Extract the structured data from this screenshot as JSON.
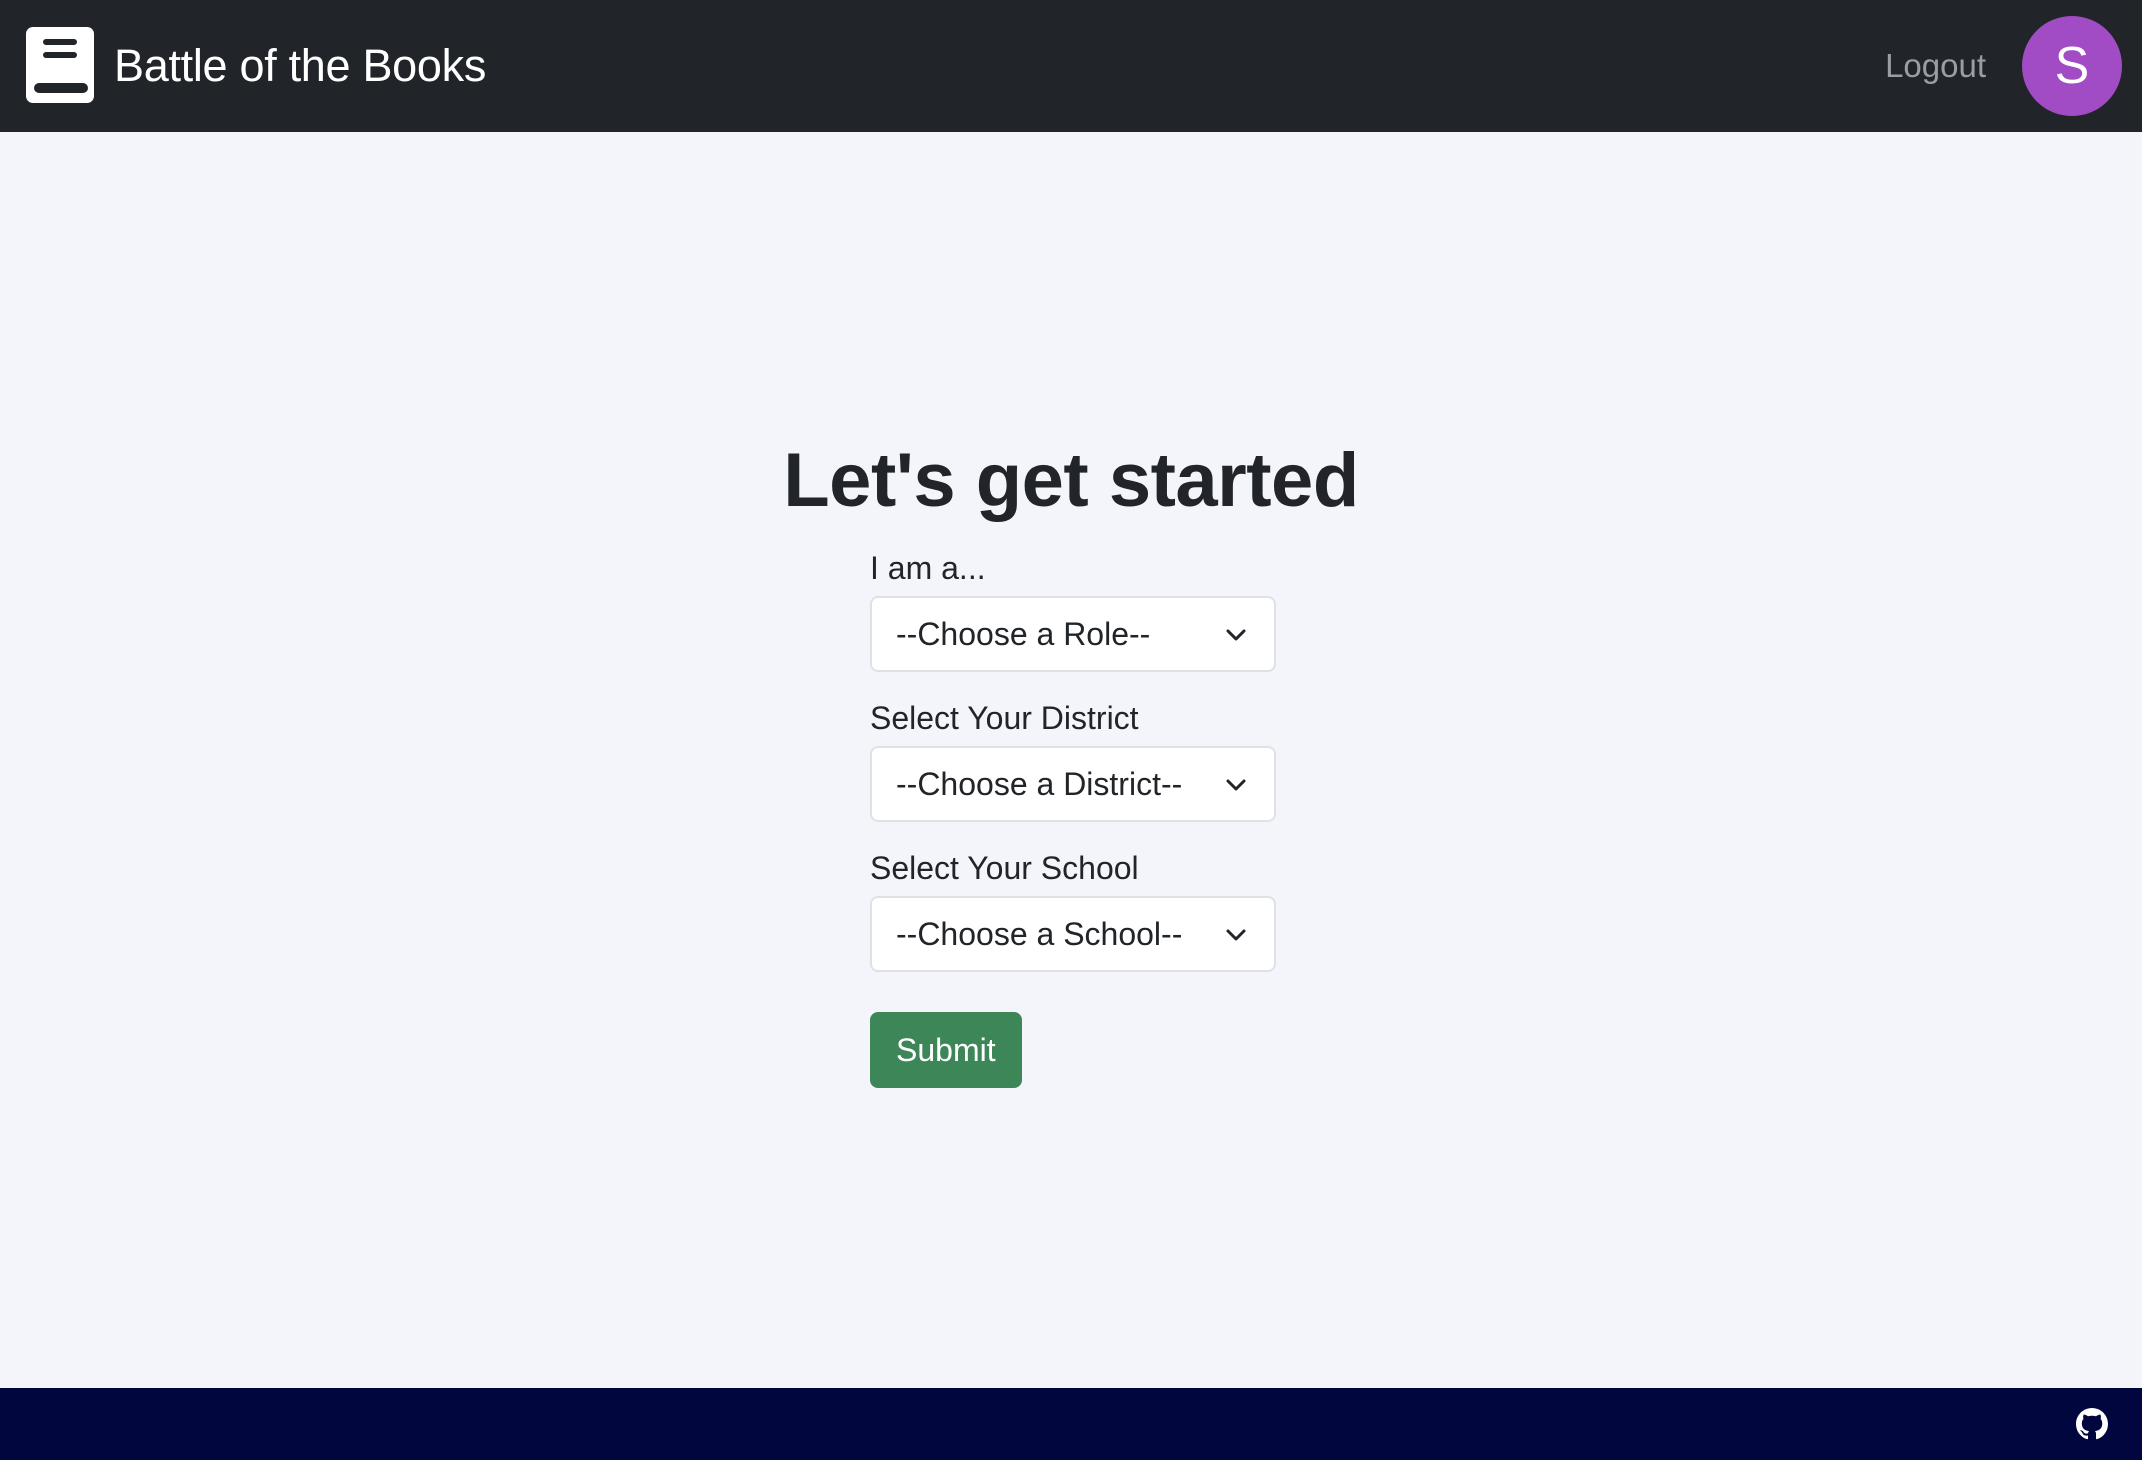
{
  "header": {
    "brand_title": "Battle of the Books",
    "brand_icon": "book-icon",
    "logout_label": "Logout",
    "avatar_initial": "S",
    "avatar_color": "#a14cc4",
    "background_color": "#212529"
  },
  "main": {
    "title": "Let's get started",
    "fields": [
      {
        "label": "I am a...",
        "selected": "--Choose a Role--"
      },
      {
        "label": "Select Your District",
        "selected": "--Choose a District--"
      },
      {
        "label": "Select Your School",
        "selected": "--Choose a School--"
      }
    ],
    "submit_label": "Submit",
    "submit_color": "#3d8658"
  },
  "footer": {
    "icon": "github-icon",
    "background_color": "#02063f"
  }
}
